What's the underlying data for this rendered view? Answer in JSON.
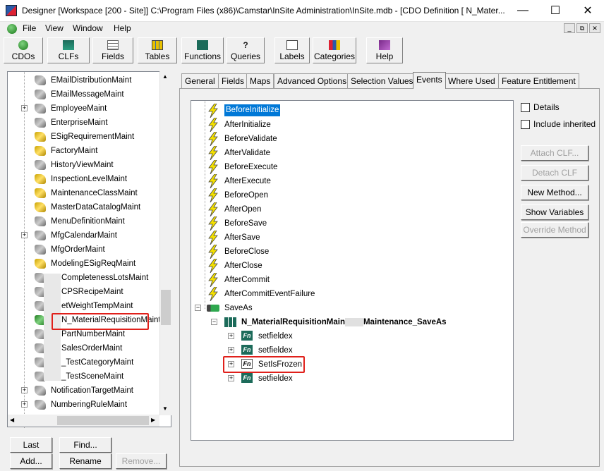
{
  "window": {
    "title": "Designer [Workspace [200 - Site]]  C:\\Program Files (x86)\\Camstar\\InSite Administration\\InSite.mdb - [CDO Definition [ N_Mater...",
    "minimize_glyph": "—",
    "maximize_glyph": "☐",
    "close_glyph": "✕"
  },
  "menu": {
    "items": [
      "File",
      "View",
      "Window",
      "Help"
    ],
    "mdi_controls": [
      "_",
      "⧉",
      "✕"
    ]
  },
  "toolbar": {
    "buttons": [
      "CDOs",
      "CLFs",
      "Fields",
      "Tables",
      "Functions",
      "Queries",
      "Labels",
      "Categories",
      "Help"
    ]
  },
  "left_tree": {
    "items": [
      {
        "label": "EMailDistributionMaint",
        "expandable": false,
        "icon": "wrench-icon"
      },
      {
        "label": "EMailMessageMaint",
        "expandable": false,
        "icon": "wrench-icon"
      },
      {
        "label": "EmployeeMaint",
        "expandable": true,
        "icon": "wrench-icon"
      },
      {
        "label": "EnterpriseMaint",
        "expandable": false,
        "icon": "wrench-icon"
      },
      {
        "label": "ESigRequirementMaint",
        "expandable": false,
        "icon": "gold-wrench-icon"
      },
      {
        "label": "FactoryMaint",
        "expandable": false,
        "icon": "gold-wrench-icon"
      },
      {
        "label": "HistoryViewMaint",
        "expandable": false,
        "icon": "wrench-icon"
      },
      {
        "label": "InspectionLevelMaint",
        "expandable": false,
        "icon": "gold-wrench-icon"
      },
      {
        "label": "MaintenanceClassMaint",
        "expandable": false,
        "icon": "gold-wrench-icon"
      },
      {
        "label": "MasterDataCatalogMaint",
        "expandable": false,
        "icon": "gold-wrench-icon"
      },
      {
        "label": "MenuDefinitionMaint",
        "expandable": false,
        "icon": "wrench-icon"
      },
      {
        "label": "MfgCalendarMaint",
        "expandable": true,
        "icon": "wrench-icon"
      },
      {
        "label": "MfgOrderMaint",
        "expandable": false,
        "icon": "wrench-icon"
      },
      {
        "label": "ModelingESigReqMaint",
        "expandable": false,
        "icon": "gold-wrench-icon"
      },
      {
        "label": "CompletenessLotsMaint",
        "expandable": false,
        "icon": "wrench-icon"
      },
      {
        "label": "CPSRecipeMaint",
        "expandable": false,
        "icon": "wrench-icon"
      },
      {
        "label": "etWeightTempMaint",
        "expandable": false,
        "icon": "wrench-icon"
      },
      {
        "label": "N_MaterialRequisitionMaint",
        "expandable": false,
        "icon": "green-wrench-icon"
      },
      {
        "label": "PartNumberMaint",
        "expandable": false,
        "icon": "wrench-icon"
      },
      {
        "label": "SalesOrderMaint",
        "expandable": false,
        "icon": "wrench-icon"
      },
      {
        "label": "_TestCategoryMaint",
        "expandable": false,
        "icon": "wrench-icon"
      },
      {
        "label": "_TestSceneMaint",
        "expandable": false,
        "icon": "wrench-icon"
      },
      {
        "label": "NotificationTargetMaint",
        "expandable": true,
        "icon": "wrench-icon"
      },
      {
        "label": "NumberingRuleMaint",
        "expandable": true,
        "icon": "wrench-icon"
      }
    ]
  },
  "left_buttons": {
    "last": "Last",
    "find": "Find...",
    "add": "Add...",
    "rename": "Rename",
    "remove": "Remove..."
  },
  "tabs": [
    "General",
    "Fields",
    "Maps",
    "Advanced Options",
    "Selection Values",
    "Events",
    "Where Used",
    "Feature Entitlement"
  ],
  "active_tab": "Events",
  "events": {
    "items": [
      "BeforeInitialize",
      "AfterInitialize",
      "BeforeValidate",
      "AfterValidate",
      "BeforeExecute",
      "AfterExecute",
      "BeforeOpen",
      "AfterOpen",
      "BeforeSave",
      "AfterSave",
      "BeforeClose",
      "AfterClose",
      "AfterCommit",
      "AfterCommitEventFailure"
    ],
    "saveas_label": "SaveAs",
    "method_label": "N_MaterialRequisitionMain",
    "method_label_suffix": "Maintenance_SaveAs",
    "children": [
      "setfieldex",
      "setfieldex",
      "SetIsFrozen",
      "setfieldex"
    ]
  },
  "right_options": {
    "details": "Details",
    "include_inherited": "Include inherited",
    "attach_clf": "Attach CLF...",
    "detach_clf": "Detach CLF",
    "new_method": "New Method...",
    "show_variables": "Show Variables",
    "override_method": "Override Method"
  },
  "colors": {
    "highlight": "#e0201b",
    "selection": "#0078d7",
    "bolt": "#f5e100"
  }
}
